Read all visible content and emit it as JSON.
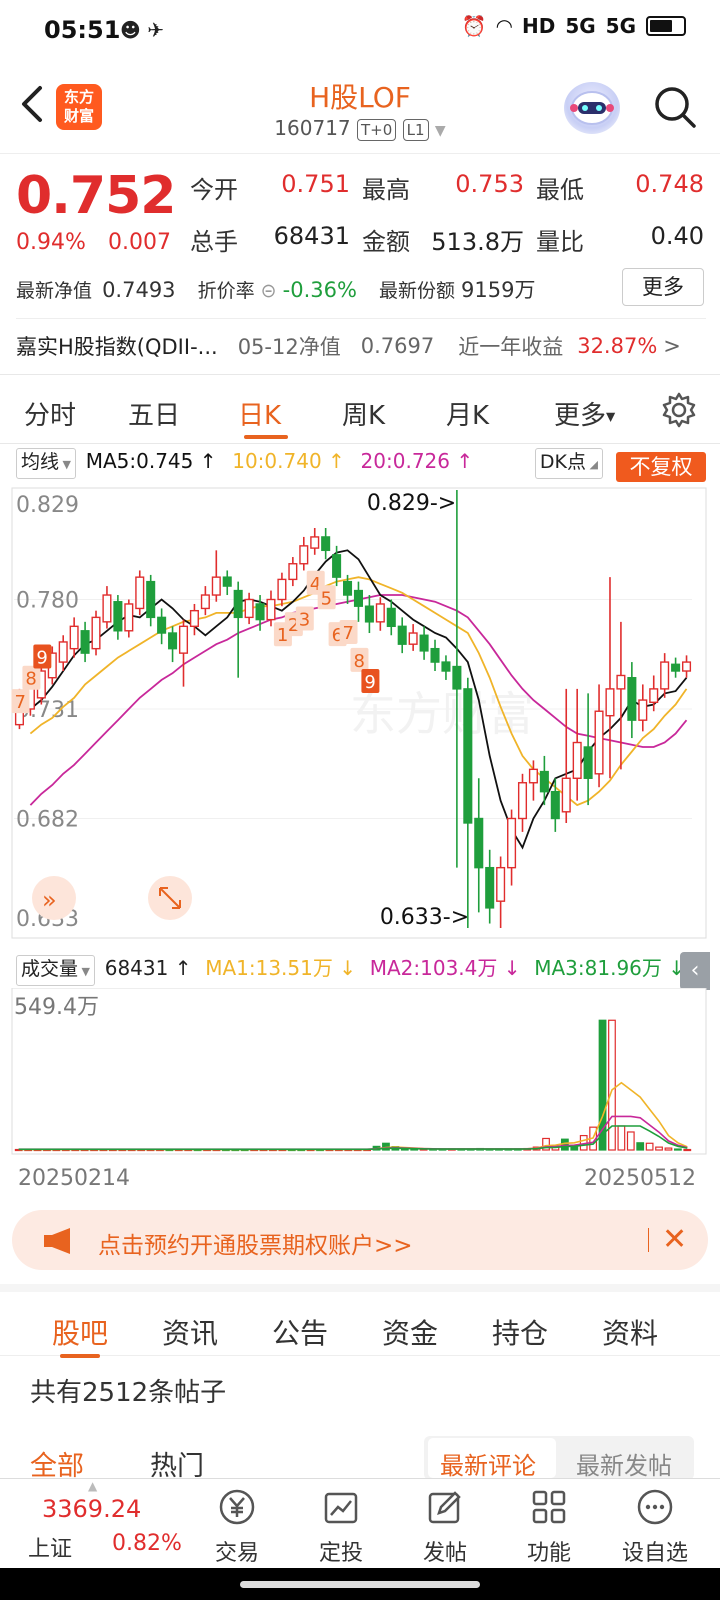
{
  "status": {
    "time": "05:51",
    "icons": [
      "alarm-icon",
      "wifi-icon",
      "HD",
      "5G",
      "5G",
      "battery-icon"
    ]
  },
  "header": {
    "title": "H股LOF",
    "code": "160717",
    "tag1": "T+0",
    "tag2": "L1",
    "logo_line1": "东方",
    "logo_line2": "财富"
  },
  "quote": {
    "price": "0.752",
    "pct": "0.94%",
    "chg": "0.007",
    "open_label": "今开",
    "open": "0.751",
    "high_label": "最高",
    "high": "0.753",
    "low_label": "最低",
    "low": "0.748",
    "vol_label": "总手",
    "vol": "68431",
    "amt_label": "金额",
    "amt": "513.8万",
    "ratio_label": "量比",
    "ratio": "0.40",
    "nav_label": "最新净值",
    "nav": "0.7493",
    "disc_label": "折价率",
    "disc": "-0.36%",
    "share_label": "最新份额",
    "share": "9159万",
    "more": "更多"
  },
  "index_row": {
    "name": "嘉实H股指数(QDII-...",
    "date_label": "05-12净值",
    "nav": "0.7697",
    "ret_label": "近一年收益",
    "ret": "32.87%",
    "arrow": ">"
  },
  "chart_tabs": [
    "分时",
    "五日",
    "日K",
    "周K",
    "月K",
    "更多"
  ],
  "ma_row": {
    "type": "均线",
    "ma5": "MA5:0.745",
    "ma10": "10:0.740",
    "ma20": "20:0.726",
    "dk": "DK点",
    "fq": "不复权"
  },
  "vol_row": {
    "type": "成交量",
    "v": "68431",
    "ma1": "MA1:13.51万",
    "ma2": "MA2:103.4万",
    "ma3": "MA3:81.96万"
  },
  "colors": {
    "up": "#e02d2d",
    "down": "#1f9e3c",
    "ma5": "#111111",
    "ma10": "#f0b429",
    "ma20": "#c8289a",
    "accent": "#e8631f"
  },
  "chart_data": {
    "type": "candlestick",
    "price_axis_labels": [
      "0.829",
      "0.780",
      "0.731",
      "0.682",
      "0.633"
    ],
    "ylim": [
      0.633,
      0.829
    ],
    "max_label": "0.829->",
    "min_label": "0.633->",
    "watermark": "东方财富",
    "dk_marks": [
      "7",
      "8",
      "9",
      "1",
      "2",
      "3",
      "4",
      "5",
      "6",
      "7",
      "8",
      "9"
    ],
    "candles": [
      [
        0.724,
        0.738,
        0.722,
        0.74
      ],
      [
        0.731,
        0.742,
        0.728,
        0.746
      ],
      [
        0.736,
        0.748,
        0.733,
        0.751
      ],
      [
        0.745,
        0.756,
        0.742,
        0.759
      ],
      [
        0.752,
        0.761,
        0.748,
        0.764
      ],
      [
        0.758,
        0.768,
        0.754,
        0.772
      ],
      [
        0.766,
        0.756,
        0.752,
        0.77
      ],
      [
        0.758,
        0.772,
        0.755,
        0.775
      ],
      [
        0.77,
        0.782,
        0.767,
        0.786
      ],
      [
        0.779,
        0.766,
        0.762,
        0.782
      ],
      [
        0.766,
        0.778,
        0.763,
        0.78
      ],
      [
        0.776,
        0.79,
        0.773,
        0.793
      ],
      [
        0.788,
        0.772,
        0.768,
        0.791
      ],
      [
        0.772,
        0.765,
        0.76,
        0.776
      ],
      [
        0.765,
        0.758,
        0.752,
        0.768
      ],
      [
        0.756,
        0.768,
        0.741,
        0.771
      ],
      [
        0.768,
        0.775,
        0.764,
        0.778
      ],
      [
        0.776,
        0.782,
        0.773,
        0.786
      ],
      [
        0.782,
        0.79,
        0.779,
        0.802
      ],
      [
        0.79,
        0.786,
        0.782,
        0.793
      ],
      [
        0.784,
        0.772,
        0.745,
        0.788
      ],
      [
        0.772,
        0.78,
        0.769,
        0.783
      ],
      [
        0.778,
        0.771,
        0.766,
        0.782
      ],
      [
        0.771,
        0.78,
        0.768,
        0.784
      ],
      [
        0.78,
        0.789,
        0.777,
        0.792
      ],
      [
        0.789,
        0.796,
        0.786,
        0.799
      ],
      [
        0.796,
        0.804,
        0.793,
        0.808
      ],
      [
        0.803,
        0.808,
        0.8,
        0.812
      ],
      [
        0.808,
        0.802,
        0.798,
        0.812
      ],
      [
        0.8,
        0.79,
        0.786,
        0.804
      ],
      [
        0.788,
        0.782,
        0.778,
        0.791
      ],
      [
        0.784,
        0.777,
        0.77,
        0.788
      ],
      [
        0.777,
        0.77,
        0.765,
        0.782
      ],
      [
        0.77,
        0.778,
        0.766,
        0.781
      ],
      [
        0.776,
        0.768,
        0.764,
        0.78
      ],
      [
        0.768,
        0.76,
        0.756,
        0.772
      ],
      [
        0.76,
        0.765,
        0.757,
        0.769
      ],
      [
        0.764,
        0.757,
        0.753,
        0.768
      ],
      [
        0.758,
        0.752,
        0.748,
        0.762
      ],
      [
        0.752,
        0.748,
        0.744,
        0.755
      ],
      [
        0.75,
        0.74,
        0.66,
        0.829
      ],
      [
        0.74,
        0.68,
        0.633,
        0.745
      ],
      [
        0.682,
        0.66,
        0.64,
        0.7
      ],
      [
        0.66,
        0.642,
        0.635,
        0.668
      ],
      [
        0.645,
        0.66,
        0.633,
        0.665
      ],
      [
        0.66,
        0.682,
        0.652,
        0.686
      ],
      [
        0.682,
        0.698,
        0.676,
        0.702
      ],
      [
        0.698,
        0.704,
        0.69,
        0.708
      ],
      [
        0.703,
        0.694,
        0.688,
        0.71
      ],
      [
        0.694,
        0.682,
        0.676,
        0.7
      ],
      [
        0.685,
        0.7,
        0.68,
        0.74
      ],
      [
        0.7,
        0.716,
        0.69,
        0.74
      ],
      [
        0.714,
        0.7,
        0.688,
        0.738
      ],
      [
        0.702,
        0.73,
        0.696,
        0.742
      ],
      [
        0.728,
        0.74,
        0.7,
        0.79
      ],
      [
        0.74,
        0.746,
        0.704,
        0.77
      ],
      [
        0.745,
        0.726,
        0.718,
        0.752
      ],
      [
        0.726,
        0.735,
        0.721,
        0.742
      ],
      [
        0.734,
        0.74,
        0.73,
        0.746
      ],
      [
        0.74,
        0.752,
        0.736,
        0.756
      ],
      [
        0.751,
        0.748,
        0.745,
        0.754
      ],
      [
        0.748,
        0.752,
        0.745,
        0.755
      ]
    ],
    "ma5": [
      0.731,
      0.735,
      0.741,
      0.748,
      0.755,
      0.76,
      0.762,
      0.766,
      0.77,
      0.773,
      0.772,
      0.776,
      0.78,
      0.776,
      0.771,
      0.768,
      0.764,
      0.768,
      0.772,
      0.779,
      0.78,
      0.779,
      0.777,
      0.775,
      0.779,
      0.784,
      0.791,
      0.797,
      0.801,
      0.802,
      0.798,
      0.79,
      0.782,
      0.779,
      0.775,
      0.771,
      0.768,
      0.765,
      0.763,
      0.758,
      0.752,
      0.735,
      0.71,
      0.69,
      0.677,
      0.669,
      0.682,
      0.69,
      0.7,
      0.702,
      0.704,
      0.712,
      0.718,
      0.722,
      0.727,
      0.735,
      0.732,
      0.733,
      0.738,
      0.739,
      0.745
    ],
    "ma10": [
      0.72,
      0.724,
      0.727,
      0.732,
      0.736,
      0.742,
      0.746,
      0.75,
      0.754,
      0.757,
      0.76,
      0.763,
      0.766,
      0.768,
      0.77,
      0.771,
      0.772,
      0.774,
      0.774,
      0.774,
      0.776,
      0.777,
      0.777,
      0.778,
      0.779,
      0.781,
      0.783,
      0.786,
      0.788,
      0.789,
      0.79,
      0.789,
      0.787,
      0.785,
      0.783,
      0.78,
      0.777,
      0.774,
      0.771,
      0.768,
      0.765,
      0.756,
      0.745,
      0.732,
      0.72,
      0.71,
      0.704,
      0.7,
      0.696,
      0.692,
      0.688,
      0.69,
      0.694,
      0.699,
      0.706,
      0.712,
      0.718,
      0.722,
      0.728,
      0.733,
      0.74
    ],
    "ma20": [
      0.688,
      0.693,
      0.697,
      0.702,
      0.706,
      0.711,
      0.716,
      0.721,
      0.726,
      0.731,
      0.736,
      0.74,
      0.744,
      0.747,
      0.751,
      0.754,
      0.757,
      0.76,
      0.762,
      0.765,
      0.767,
      0.769,
      0.771,
      0.772,
      0.774,
      0.775,
      0.776,
      0.777,
      0.778,
      0.779,
      0.78,
      0.781,
      0.782,
      0.782,
      0.782,
      0.781,
      0.78,
      0.779,
      0.777,
      0.775,
      0.772,
      0.766,
      0.76,
      0.753,
      0.746,
      0.74,
      0.735,
      0.731,
      0.727,
      0.723,
      0.72,
      0.719,
      0.718,
      0.717,
      0.716,
      0.715,
      0.714,
      0.714,
      0.716,
      0.72,
      0.726
    ],
    "vol_axis_label": "549.4万",
    "vol_max": 549.4,
    "volumes": [
      2,
      2,
      2,
      2,
      2,
      2,
      2,
      2,
      2,
      2,
      2,
      2,
      2,
      2,
      2,
      2,
      2,
      2,
      2,
      2,
      2,
      2,
      2,
      2,
      2,
      2,
      2,
      2,
      2,
      2,
      2,
      2,
      2,
      2,
      2,
      2,
      2,
      2,
      15,
      28,
      14,
      8,
      6,
      4,
      4,
      4,
      4,
      4,
      4,
      6,
      4,
      4,
      4,
      4,
      6,
      12,
      48,
      12,
      45,
      12,
      60,
      95,
      540,
      540,
      100,
      75,
      30,
      28,
      12,
      8,
      4,
      2
    ],
    "vol_ma1": [
      2,
      2,
      2,
      2,
      2,
      2,
      2,
      2,
      2,
      2,
      2,
      2,
      2,
      2,
      2,
      2,
      2,
      2,
      2,
      2,
      2,
      2,
      2,
      2,
      2,
      2,
      2,
      2,
      2,
      2,
      2,
      2,
      2,
      2,
      2,
      2,
      2,
      2,
      5,
      10,
      12,
      10,
      8,
      6,
      5,
      4,
      4,
      4,
      4,
      4,
      4,
      4,
      4,
      4,
      5,
      8,
      18,
      20,
      28,
      30,
      40,
      50,
      140,
      250,
      280,
      250,
      220,
      170,
      120,
      60,
      30,
      13.51
    ],
    "date_start": "20250214",
    "date_end": "20250512"
  },
  "banner": {
    "text": "点击预约开通股票期权账户>>"
  },
  "sub_tabs": [
    "股吧",
    "资讯",
    "公告",
    "资金",
    "持仓",
    "资料"
  ],
  "post_count": "共有2512条帖子",
  "filter": {
    "all": "全部",
    "hot": "热门",
    "latest_comment": "最新评论",
    "latest_post": "最新发帖"
  },
  "bottom_nav": {
    "index_value": "3369.24",
    "index_name": "上证",
    "index_pct": "0.82%",
    "items": [
      "交易",
      "定投",
      "发帖",
      "功能",
      "设自选"
    ]
  }
}
